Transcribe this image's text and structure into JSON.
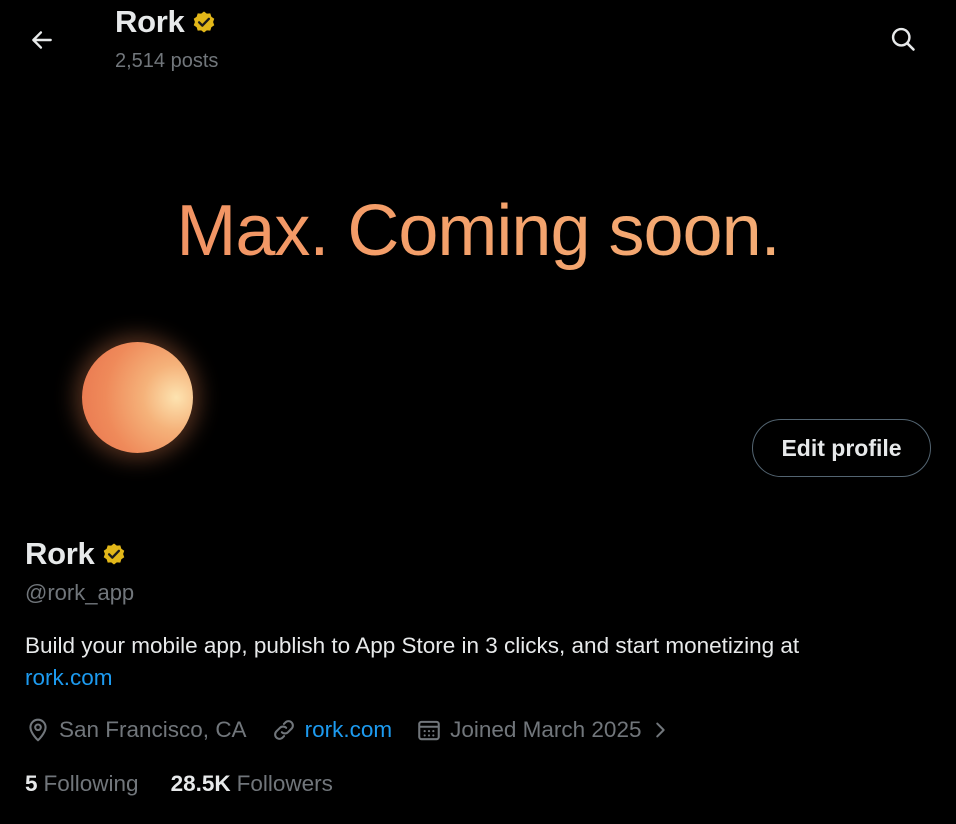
{
  "header": {
    "title": "Rork",
    "posts": "2,514 posts"
  },
  "banner": {
    "text": "Max. Coming soon."
  },
  "edit_profile_label": "Edit profile",
  "profile": {
    "name": "Rork",
    "handle": "@rork_app",
    "bio_text": "Build your mobile app, publish to App Store in 3 clicks, and start monetizing at",
    "bio_link": "rork.com",
    "location": "San Francisco, CA",
    "website": "rork.com",
    "joined": "Joined March 2025",
    "following_count": "5",
    "following_label": "Following",
    "followers_count": "28.5K",
    "followers_label": "Followers"
  },
  "icons": {
    "back": "arrow-left-icon",
    "search": "search-icon",
    "verified": "verified-badge-icon",
    "location": "location-pin-icon",
    "link": "link-icon",
    "calendar": "calendar-icon",
    "chevron": "chevron-right-icon"
  },
  "colors": {
    "background": "#000000",
    "text_primary": "#e7e9ea",
    "text_secondary": "#71767b",
    "link": "#1d9bf0",
    "verified_gold": "#e2b719",
    "banner_orange": "#f08a5e"
  }
}
